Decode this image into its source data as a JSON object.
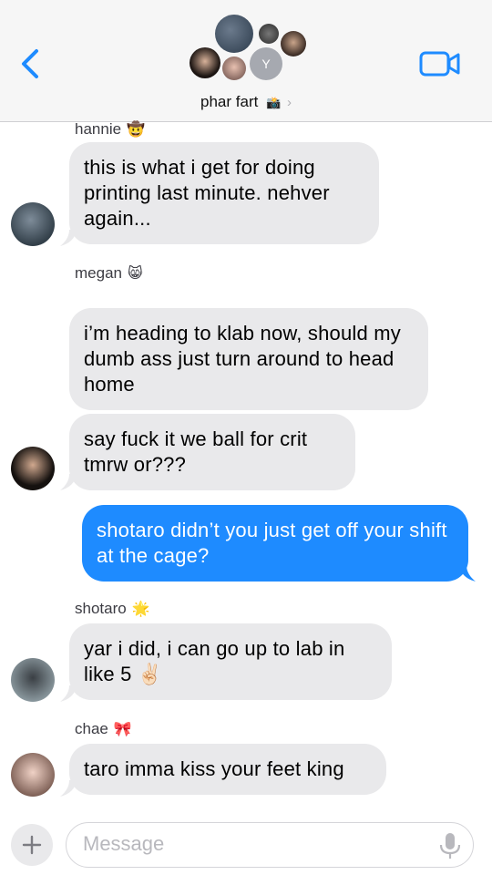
{
  "header": {
    "group_name": "phar fart",
    "group_emoji": "📸",
    "avatar_letter": "Y",
    "accent_color": "#1e8bff"
  },
  "messages": [
    {
      "sender": "hannie",
      "sender_emoji": "🤠",
      "text": "this is what i get for doing printing last minute. nehver again..."
    },
    {
      "sender": "megan",
      "sender_emoji": "😸",
      "text1": "i’m heading to klab now, should my dumb ass just turn around to head home",
      "text2": "say fuck it we ball for crit tmrw or???"
    },
    {
      "sender": "me",
      "text": "shotaro didn’t you just get off your shift at the cage?"
    },
    {
      "sender": "shotaro",
      "sender_emoji": "🌟",
      "text": "yar i did, i can go up to lab in like 5 ✌🏻"
    },
    {
      "sender": "chae",
      "sender_emoji": "🎀",
      "text": "taro imma kiss your feet king"
    }
  ],
  "composer": {
    "placeholder": "Message"
  }
}
